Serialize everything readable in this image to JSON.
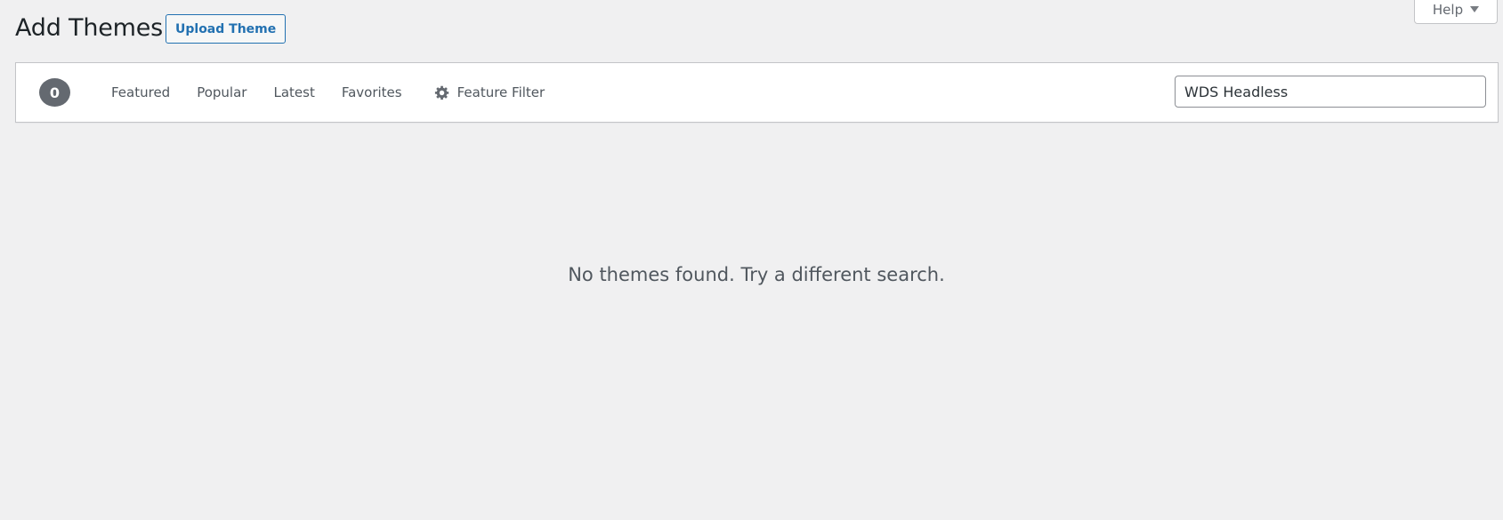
{
  "header": {
    "title": "Add Themes",
    "upload_button_label": "Upload Theme",
    "help_label": "Help"
  },
  "filter_bar": {
    "count": "0",
    "links": [
      {
        "label": "Featured"
      },
      {
        "label": "Popular"
      },
      {
        "label": "Latest"
      },
      {
        "label": "Favorites"
      }
    ],
    "feature_filter_label": "Feature Filter",
    "feature_filter_icon": "gear-icon",
    "search_value": "WDS Headless"
  },
  "main": {
    "empty_message": "No themes found. Try a different search."
  },
  "colors": {
    "accent": "#2271b1",
    "background": "#f0f0f1",
    "badge": "#646970"
  }
}
